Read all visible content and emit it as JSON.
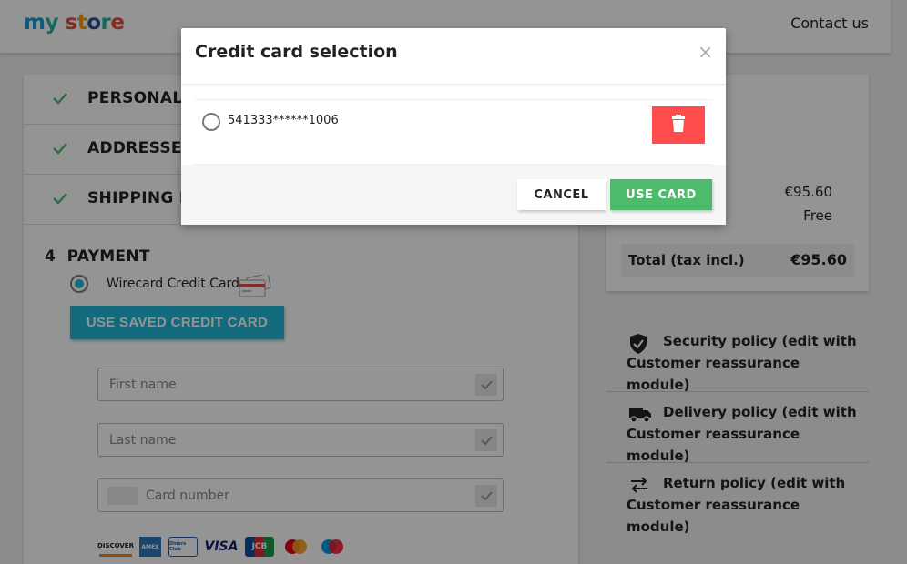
{
  "header": {
    "logo_parts": [
      {
        "text": "m",
        "color": "#1a9ad7"
      },
      {
        "text": "y",
        "color": "#26b4a4"
      },
      {
        "text": " ",
        "color": "#000000"
      },
      {
        "text": "s",
        "color": "#e84c3d"
      },
      {
        "text": "t",
        "color": "#f39c12"
      },
      {
        "text": "o",
        "color": "#2c4ea1"
      },
      {
        "text": "r",
        "color": "#26b4a4"
      },
      {
        "text": "e",
        "color": "#e84c3d"
      }
    ],
    "contact": "Contact us"
  },
  "steps": [
    {
      "label": "PERSONAL INFORMATION",
      "done": true
    },
    {
      "label": "ADDRESSES",
      "done": true
    },
    {
      "label": "SHIPPING METHOD",
      "done": true
    }
  ],
  "payment": {
    "number": "4",
    "title": "PAYMENT",
    "method_label": "Wirecard Credit Card",
    "saved_button": "USE SAVED CREDIT CARD",
    "fields": {
      "first_name": "First name",
      "last_name": "Last name",
      "card_number": "Card number"
    },
    "brands": [
      "DISCOVER",
      "AMEX",
      "Diners Club",
      "VISA",
      "JCB",
      "mastercard",
      "maestro"
    ]
  },
  "summary": {
    "subtotal_value": "€95.60",
    "shipping_value": "Free",
    "total_label": "Total (tax incl.)",
    "total_value": "€95.60"
  },
  "reassurance": [
    {
      "icon": "shield-icon",
      "text": "Security policy (edit with Customer reassurance module)"
    },
    {
      "icon": "truck-icon",
      "text": "Delivery policy (edit with Customer reassurance module)"
    },
    {
      "icon": "swap-arrows-icon",
      "text": "Return policy (edit with Customer reassurance module)"
    }
  ],
  "modal": {
    "title": "Credit card selection",
    "close": "×",
    "card_number": "541333******1006",
    "cancel": "CANCEL",
    "use_card": "USE CARD"
  },
  "colors": {
    "accent": "#24b9d7",
    "success": "#4cbb6c",
    "danger": "#ff4c4c",
    "check": "#4cbb6c"
  }
}
